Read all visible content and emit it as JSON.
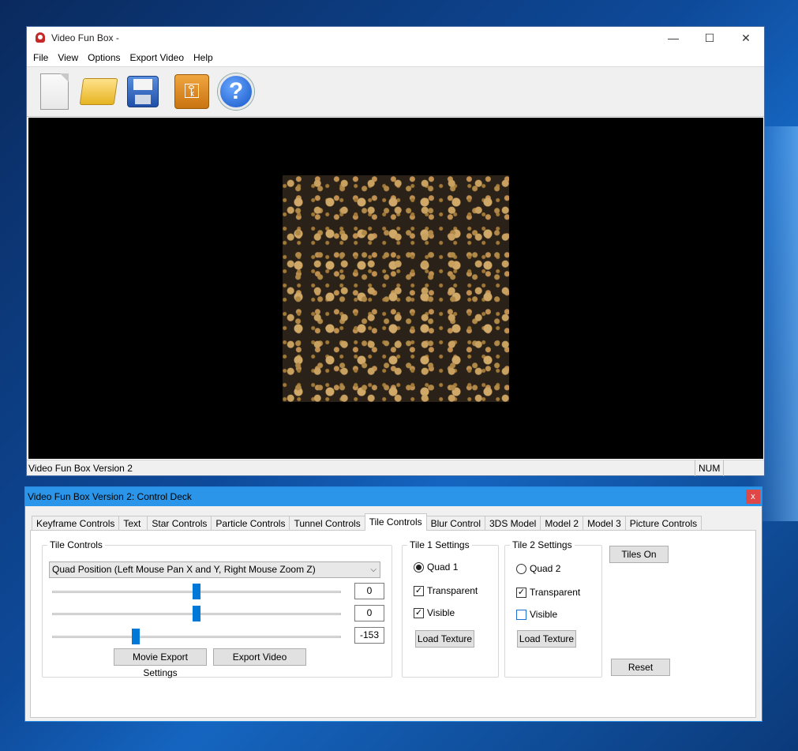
{
  "main_window": {
    "title": "Video Fun Box -",
    "minimize_glyph": "—",
    "maximize_glyph": "☐",
    "close_glyph": "✕",
    "menu": [
      "File",
      "View",
      "Options",
      "Export Video",
      "Help"
    ],
    "toolbar": [
      {
        "name": "new-file",
        "icon": "new-file-icon"
      },
      {
        "name": "open-folder",
        "icon": "open-folder-icon"
      },
      {
        "name": "save",
        "icon": "save-icon"
      },
      {
        "name": "key",
        "icon": "key-icon",
        "glyph": "⚿"
      },
      {
        "name": "help",
        "icon": "help-icon",
        "glyph": "?"
      }
    ],
    "status": {
      "text": "Video Fun Box Version 2",
      "num": "NUM"
    }
  },
  "control_deck": {
    "title": "Video Fun Box Version 2: Control Deck",
    "close_glyph": "x",
    "tabs": [
      "Keyframe Controls",
      "Text",
      "Star Controls",
      "Particle Controls",
      "Tunnel Controls",
      "Tile Controls",
      "Blur Control",
      "3DS Model",
      "Model 2",
      "Model 3",
      "Picture Controls"
    ],
    "active_tab": "Tile Controls",
    "tile_controls": {
      "legend": "Tile Controls",
      "mode_selected": "Quad Position (Left Mouse Pan X and Y, Right Mouse Zoom Z)",
      "sliders": [
        {
          "value": "0",
          "level": 0.5
        },
        {
          "value": "0",
          "level": 0.5
        },
        {
          "value": "-153",
          "level": 0.29
        }
      ],
      "movie_export_label": "Movie Export Settings",
      "export_video_label": "Export Video"
    },
    "tile1": {
      "legend": "Tile 1 Settings",
      "quad_label": "Quad 1",
      "quad_selected": true,
      "transparent_label": "Transparent",
      "transparent_checked": true,
      "visible_label": "Visible",
      "visible_checked": true,
      "load_label": "Load Texture"
    },
    "tile2": {
      "legend": "Tile 2 Settings",
      "quad_label": "Quad 2",
      "quad_selected": false,
      "transparent_label": "Transparent",
      "transparent_checked": true,
      "visible_label": "Visible",
      "visible_checked": false,
      "load_label": "Load Texture"
    },
    "tiles_on_label": "Tiles On",
    "reset_label": "Reset",
    "check_glyph": "✓"
  },
  "colors": {
    "accent": "#0078d7",
    "deck_title_bar": "#2b95e9",
    "close_red": "#e04848"
  }
}
